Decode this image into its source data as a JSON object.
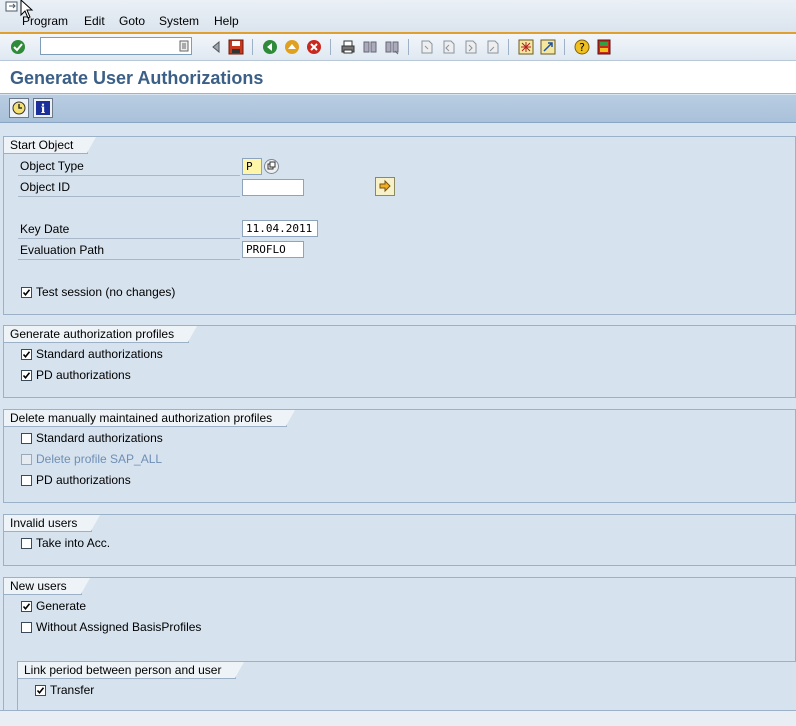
{
  "menu": {
    "items": [
      "Program",
      "Edit",
      "Goto",
      "System",
      "Help"
    ]
  },
  "toolbar": {
    "command_field_value": "",
    "icons": [
      "enter-icon",
      "save-icon",
      "back-icon",
      "exit-icon",
      "cancel-icon",
      "print-icon",
      "find-icon",
      "find-next-icon",
      "first-page-icon",
      "previous-page-icon",
      "next-page-icon",
      "last-page-icon",
      "create-session-icon",
      "shortcut-icon",
      "help-icon",
      "layout-icon"
    ]
  },
  "page": {
    "title": "Generate User Authorizations"
  },
  "app_toolbar": {
    "icons": [
      "execute-icon",
      "info-icon"
    ]
  },
  "start_object": {
    "title": "Start Object",
    "object_type_label": "Object Type",
    "object_type_value": "P",
    "object_id_label": "Object ID",
    "object_id_value": "",
    "key_date_label": "Key Date",
    "key_date_value": "11.04.2011",
    "evaluation_path_label": "Evaluation Path",
    "evaluation_path_value": "PROFLO",
    "test_session_label": "Test session (no changes)",
    "test_session_checked": true
  },
  "generate_profiles": {
    "title": "Generate authorization profiles",
    "standard_label": "Standard authorizations",
    "standard_checked": true,
    "pd_label": "PD authorizations",
    "pd_checked": true
  },
  "delete_profiles": {
    "title": "Delete manually maintained authorization profiles",
    "standard_label": "Standard authorizations",
    "standard_checked": false,
    "sap_all_label": "Delete profile SAP_ALL",
    "sap_all_checked": false,
    "pd_label": "PD authorizations",
    "pd_checked": false
  },
  "invalid_users": {
    "title": "Invalid users",
    "take_label": "Take into Acc.",
    "take_checked": false
  },
  "new_users": {
    "title": "New users",
    "generate_label": "Generate",
    "generate_checked": true,
    "without_label": "Without Assigned BasisProfiles",
    "without_checked": false,
    "link_title": "Link period between person and user",
    "transfer_label": "Transfer",
    "transfer_checked": true
  },
  "colors": {
    "title_blue": "#3b5f86",
    "accent_orange": "#e0a030",
    "section_bg": "#d6e2ee",
    "required_yellow": "#fff6a8"
  }
}
